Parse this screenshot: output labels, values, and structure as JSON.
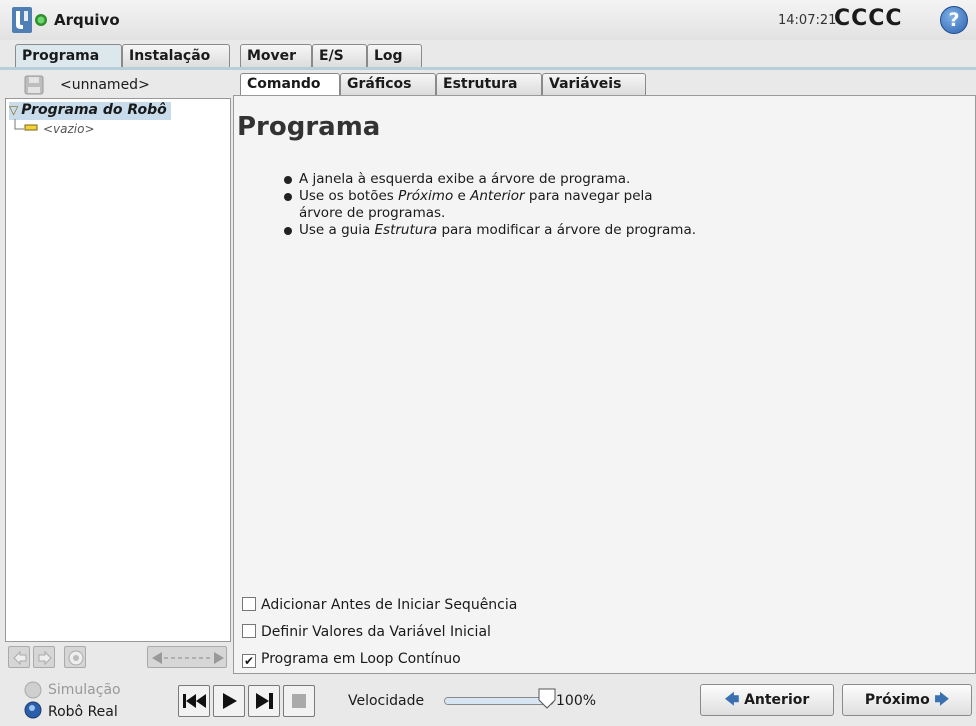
{
  "header": {
    "title": "Arquivo",
    "time": "14:07:21",
    "robot_name": "CCCC",
    "help_glyph": "?"
  },
  "main_tabs": [
    {
      "label": "Programa"
    },
    {
      "label": "Instalação"
    },
    {
      "label": "Mover"
    },
    {
      "label": "E/S"
    },
    {
      "label": "Log"
    }
  ],
  "program": {
    "file_name": "<unnamed>"
  },
  "tree": {
    "root": "Programa do Robô",
    "child": "<vazio>"
  },
  "sub_tabs": [
    {
      "label": "Comando"
    },
    {
      "label": "Gráficos"
    },
    {
      "label": "Estrutura"
    },
    {
      "label": "Variáveis"
    }
  ],
  "content": {
    "heading": "Programa",
    "bullet1": "A janela à esquerda exibe a árvore de programa.",
    "bullet2_a": "Use os botões ",
    "bullet2_b": "Próximo",
    "bullet2_c": " e ",
    "bullet2_d": "Anterior",
    "bullet2_e": " para navegar pela",
    "bullet2_f": "árvore de programas.",
    "bullet3_a": "Use a guia ",
    "bullet3_b": "Estrutura",
    "bullet3_c": " para modificar a árvore de programa."
  },
  "options": [
    {
      "label": "Adicionar Antes de Iniciar Sequência",
      "checked": false
    },
    {
      "label": "Definir Valores da Variável Inicial",
      "checked": false
    },
    {
      "label": "Programa em Loop Contínuo",
      "checked": true
    }
  ],
  "check_mark": "✔",
  "mode": {
    "simulation": "Simulação",
    "real_robot": "Robô Real"
  },
  "speed": {
    "label": "Velocidade",
    "value": "100%",
    "fraction": 1.0
  },
  "nav": {
    "previous": "Anterior",
    "next": "Próximo"
  },
  "colors": {
    "accent": "#4a80b4",
    "status_green": "#3aa63a",
    "selection": "#c8dcec"
  }
}
